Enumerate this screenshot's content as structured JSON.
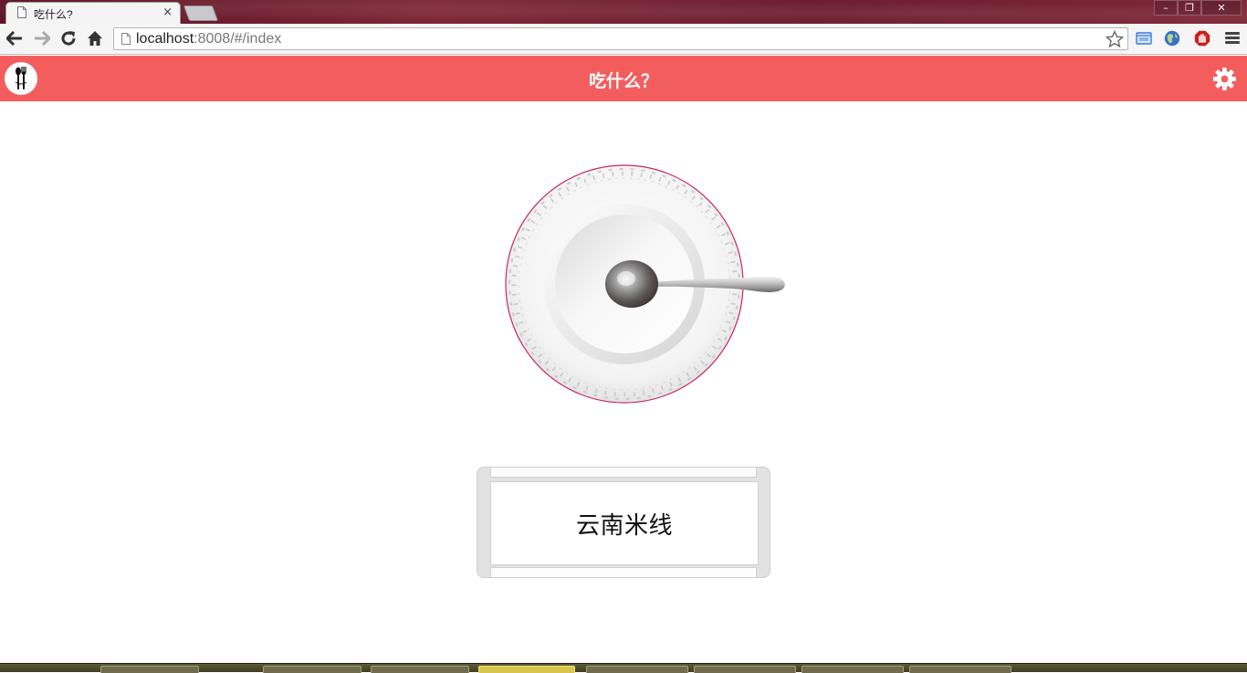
{
  "browser": {
    "tab": {
      "title": "吃什么?",
      "close_glyph": "×",
      "icon": "page-icon"
    },
    "window_controls": {
      "minimize": "–",
      "restore": "❐",
      "close": "✕"
    },
    "address": {
      "host": "localhost",
      "path": ":8008/#/index"
    },
    "toolbar_icons": [
      "back-icon",
      "forward-icon",
      "reload-icon",
      "home-icon",
      "star-icon",
      "folder-extension-icon",
      "globe-extension-icon",
      "adblock-extension-icon",
      "menu-icon"
    ]
  },
  "app": {
    "title": "吃什么？",
    "header_color": "#f45d5d",
    "logo_icon": "fork-spoon-icon",
    "settings_icon": "gear-icon"
  },
  "result": {
    "food": "云南米线"
  },
  "taskbar": {
    "item_count": 8,
    "active_item": 4
  }
}
